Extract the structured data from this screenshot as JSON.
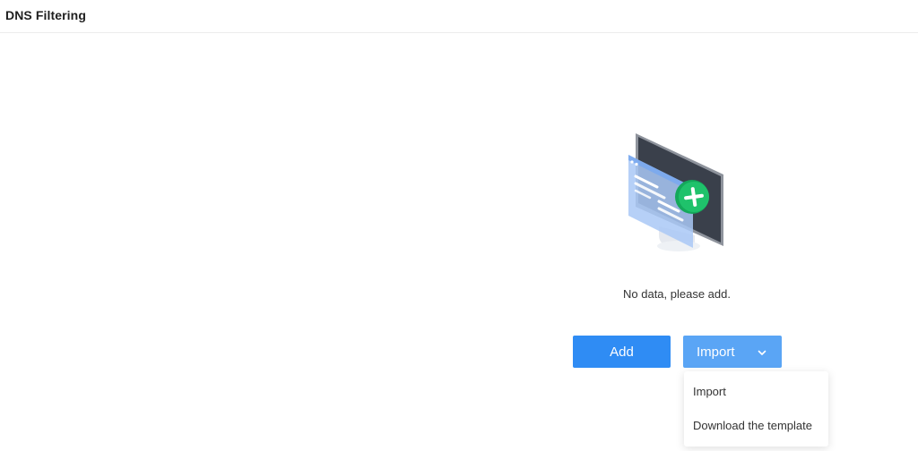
{
  "header": {
    "title": "DNS Filtering"
  },
  "empty_state": {
    "illustration": "monitor-add-icon",
    "message": "No data, please add."
  },
  "actions": {
    "add_label": "Add",
    "import_label": "Import",
    "import_caret_icon": "chevron-down-icon"
  },
  "import_menu": {
    "items": [
      {
        "label": "Import"
      },
      {
        "label": "Download the template"
      }
    ]
  },
  "colors": {
    "primary": "#2f8cf4",
    "primary_light": "#5aa5f5",
    "success": "#1fc26b",
    "border": "#ececec"
  }
}
